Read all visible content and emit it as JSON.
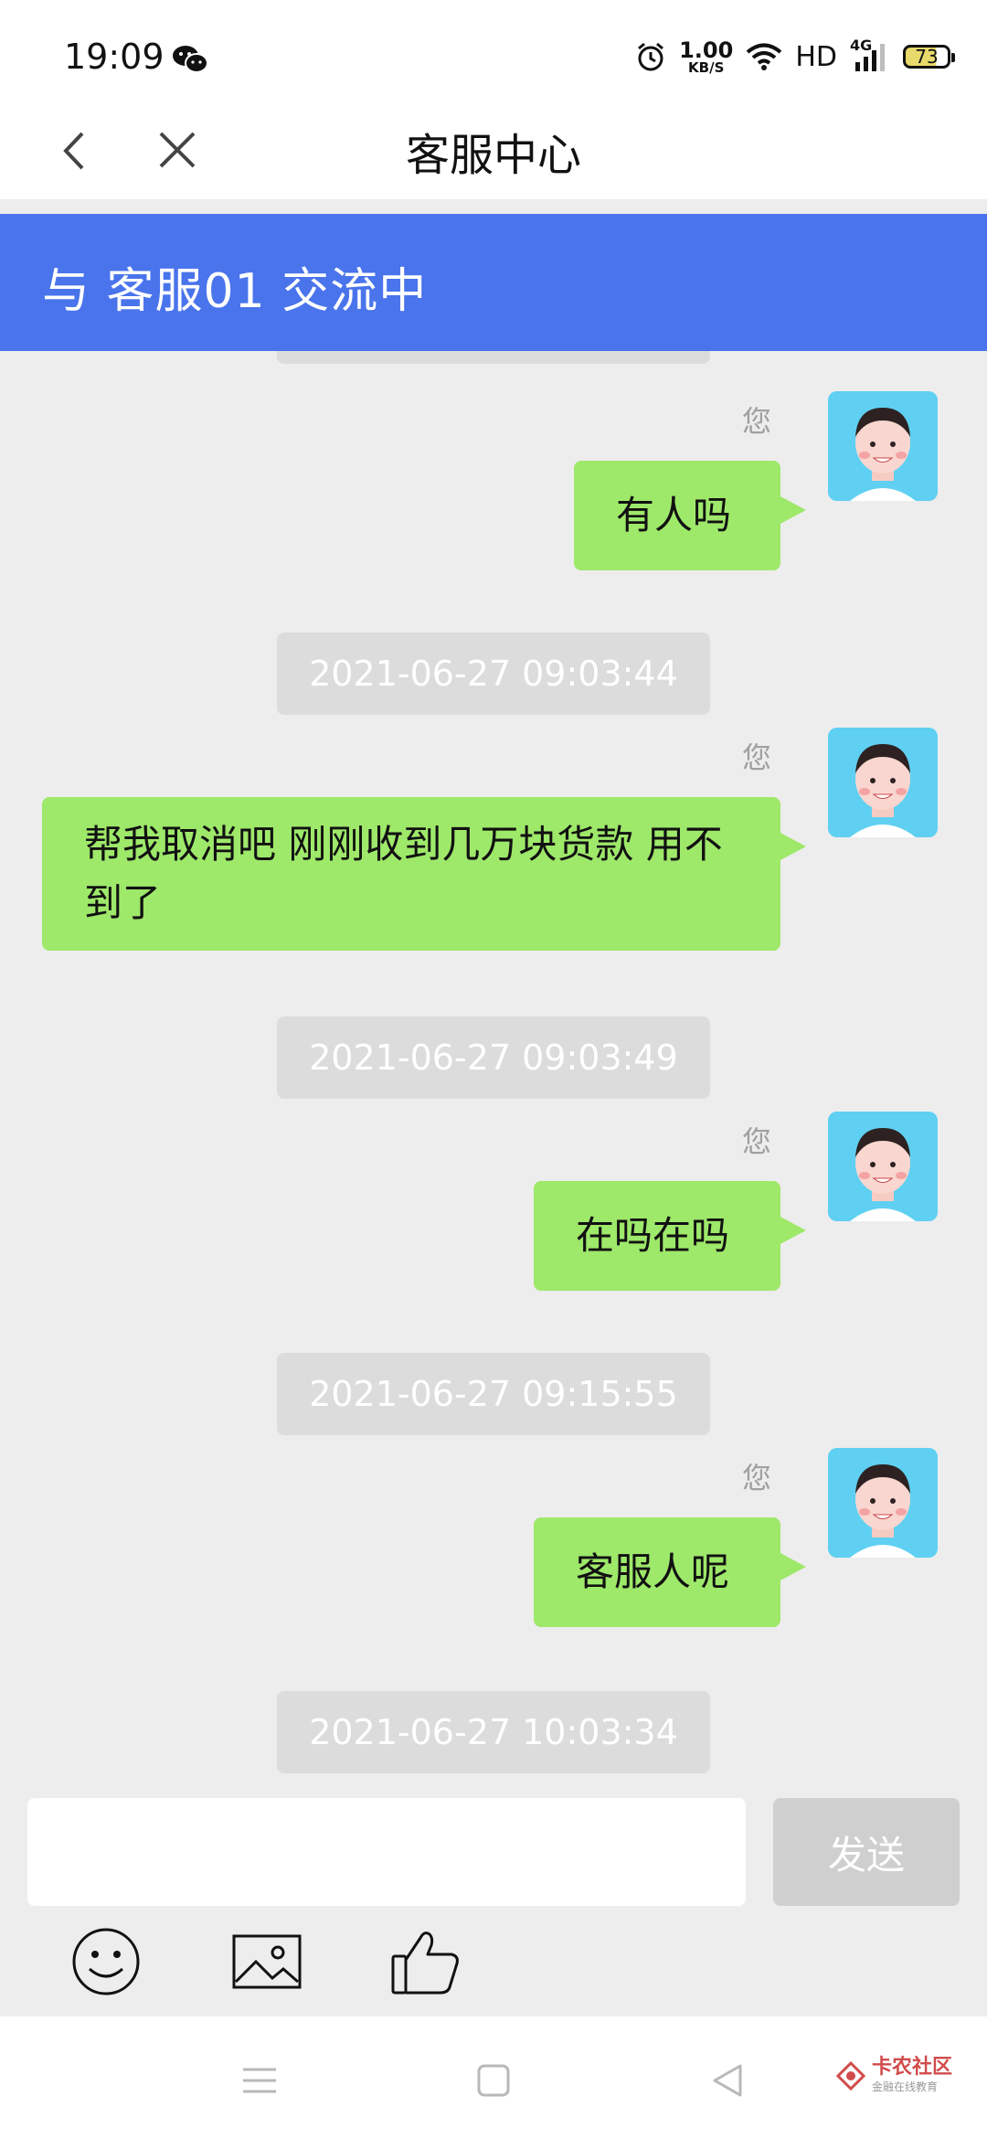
{
  "status_bar": {
    "time": "19:09",
    "speed_value": "1.00",
    "speed_unit": "KB/S",
    "network_hd": "HD",
    "network_type": "4G",
    "battery": "73",
    "icons": [
      "wechat-icon",
      "alarm-icon",
      "wifi-icon",
      "signal-icon",
      "battery-icon"
    ]
  },
  "nav": {
    "title": "客服中心",
    "back_icon": "chevron-left-icon",
    "close_icon": "close-icon"
  },
  "banner": {
    "text": "与 客服01 交流中",
    "color": "#4a74ec"
  },
  "chat": {
    "sender_label": "您",
    "bubble_color": "#9ee86a",
    "messages": [
      {
        "text": "有人吗"
      },
      {
        "timestamp": "2021-06-27 09:03:44",
        "text": "帮我取消吧 刚刚收到几万块货款 用不到了"
      },
      {
        "timestamp": "2021-06-27 09:03:49",
        "text": "在吗在吗"
      },
      {
        "timestamp": "2021-06-27 09:15:55",
        "text": "客服人呢"
      }
    ],
    "last_timestamp": "2021-06-27 10:03:34"
  },
  "input": {
    "value": "",
    "send_label": "发送"
  },
  "toolbar": {
    "icons": [
      "emoji-icon",
      "image-icon",
      "thumbs-up-icon"
    ]
  },
  "system_nav": {
    "icons": [
      "menu-icon",
      "home-icon",
      "back-icon"
    ]
  },
  "watermark": {
    "title": "卡农社区",
    "subtitle": "金融在线教育"
  }
}
